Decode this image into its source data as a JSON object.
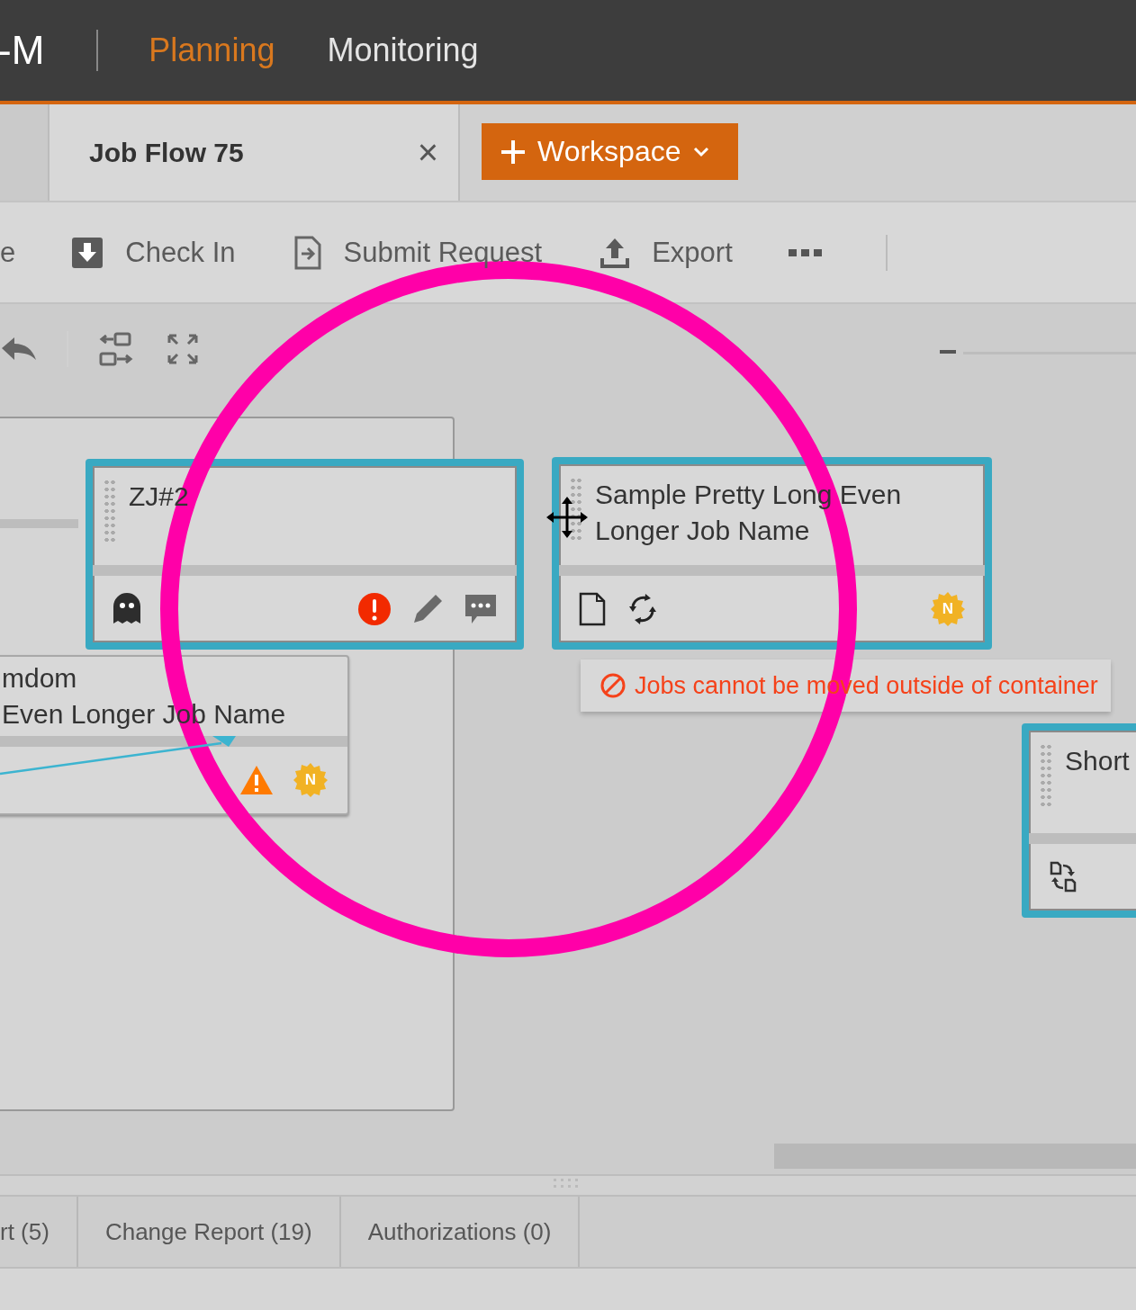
{
  "header": {
    "logo": "-M",
    "nav": [
      {
        "label": "Planning",
        "selected": true
      },
      {
        "label": "Monitoring",
        "selected": false
      }
    ]
  },
  "tabs": [
    {
      "label": "Job Flow 75",
      "selected": true,
      "close": "×"
    }
  ],
  "add_button": {
    "label": "Workspace"
  },
  "toolbar": [
    {
      "kind": "text",
      "label": "e"
    },
    {
      "kind": "checkin",
      "label": "Check In"
    },
    {
      "kind": "submit",
      "label": "Submit Request"
    },
    {
      "kind": "export",
      "label": "Export"
    }
  ],
  "jobs": [
    {
      "name": "ZJ#2",
      "selected": true,
      "left_icons": [
        {
          "kind": "ghost"
        }
      ],
      "right_icons": [
        {
          "kind": "error"
        },
        {
          "kind": "edit"
        },
        {
          "kind": "comment"
        }
      ]
    },
    {
      "name": "Sample Pretty Long Even Longer Job Name",
      "selected": true,
      "left_icons": [
        {
          "kind": "file"
        },
        {
          "kind": "cycle"
        }
      ],
      "right_icons": [
        {
          "kind": "new",
          "label": "N"
        }
      ]
    },
    {
      "name": "mdom\nEven Longer Job Name",
      "selected": false,
      "right_icons": [
        {
          "kind": "warning"
        },
        {
          "kind": "new",
          "label": "N"
        }
      ]
    },
    {
      "name": "Short",
      "selected": true,
      "left_icons": [
        {
          "kind": "swap"
        }
      ]
    }
  ],
  "toast": {
    "message": "Jobs cannot be moved outside of container"
  },
  "bottom_tabs": [
    {
      "label": "rt (5)"
    },
    {
      "label": "Change Report (19)"
    },
    {
      "label": "Authorizations (0)"
    }
  ]
}
